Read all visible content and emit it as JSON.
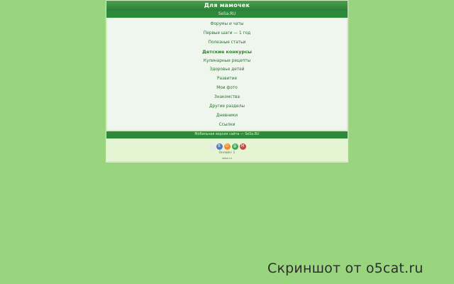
{
  "page": {
    "title": "Для мамочек",
    "subtitle": "SeSa.RU",
    "menu": [
      "Форумы и чаты",
      "Первые шаги — 1 год",
      "Полезные статьи",
      "Детские конкурсы",
      "Кулинарные рецепты",
      "Здоровье детей",
      "Развитие",
      "Мои фото",
      "Знакомства",
      "Другие разделы",
      "Дневники",
      "Ссылки"
    ],
    "footer_bar": "Мобильная версия сайта — SeSa.RU",
    "footer_counter": "Онлайн: 1",
    "footer_site": "sesa.ru"
  },
  "social": {
    "icons": [
      {
        "name": "circle-icon",
        "color": "#e9e9e9",
        "glyph": ""
      },
      {
        "name": "vk-icon",
        "color": "#4f7cc3",
        "glyph": "В"
      },
      {
        "name": "ok-icon",
        "color": "#f08c2a",
        "glyph": "О"
      },
      {
        "name": "mail-icon",
        "color": "#3ea65b",
        "glyph": "@"
      },
      {
        "name": "mm-icon",
        "color": "#c44a42",
        "glyph": "М"
      }
    ]
  },
  "watermark": "Скриншот от o5cat.ru"
}
